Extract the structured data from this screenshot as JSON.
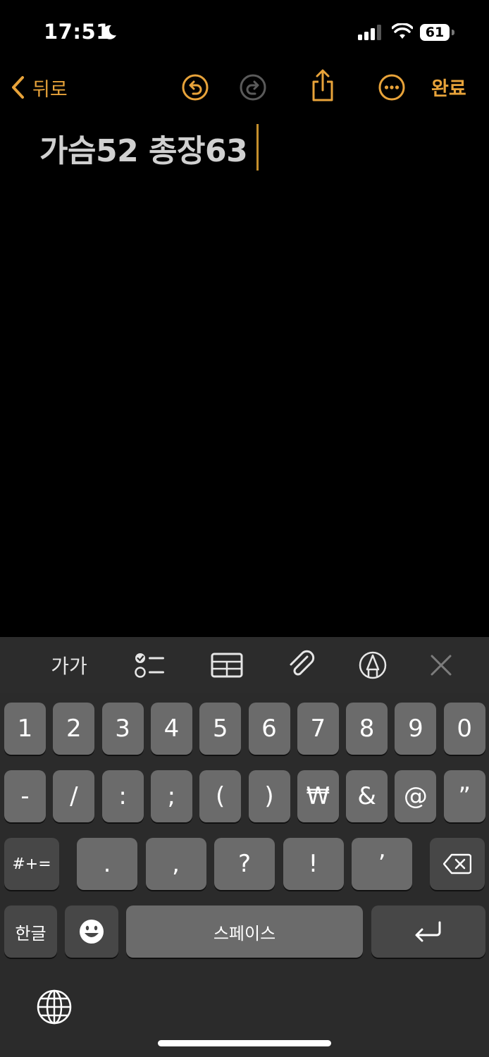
{
  "status_bar": {
    "time": "17:51",
    "battery": "61"
  },
  "nav": {
    "back_label": "뒤로",
    "done_label": "완료"
  },
  "note": {
    "text": "가슴52 총장63"
  },
  "toolbar": {
    "text_format_label": "가가"
  },
  "keyboard": {
    "row1": [
      "1",
      "2",
      "3",
      "4",
      "5",
      "6",
      "7",
      "8",
      "9",
      "0"
    ],
    "row2": [
      "-",
      "/",
      ":",
      ";",
      "(",
      ")",
      "₩",
      "&",
      "@",
      "”"
    ],
    "row3": {
      "more_symbols": "#+=",
      "keys": [
        ".",
        ",",
        "?",
        "!",
        "’"
      ]
    },
    "row4": {
      "lang": "한글",
      "space": "스페이스"
    }
  },
  "icons": {
    "nav": [
      "chevron-left-icon",
      "undo-icon",
      "redo-icon",
      "share-icon",
      "more-icon"
    ],
    "toolbar": [
      "checklist-icon",
      "table-icon",
      "paperclip-icon",
      "markup-icon",
      "close-icon"
    ],
    "keyboard": [
      "delete-icon",
      "emoji-icon",
      "return-icon",
      "globe-icon"
    ]
  },
  "colors": {
    "accent": "#e8a33a",
    "background": "#000000",
    "keyboard": "#2b2b2b",
    "key": "#6b6b6b",
    "key_dark": "#474747"
  }
}
